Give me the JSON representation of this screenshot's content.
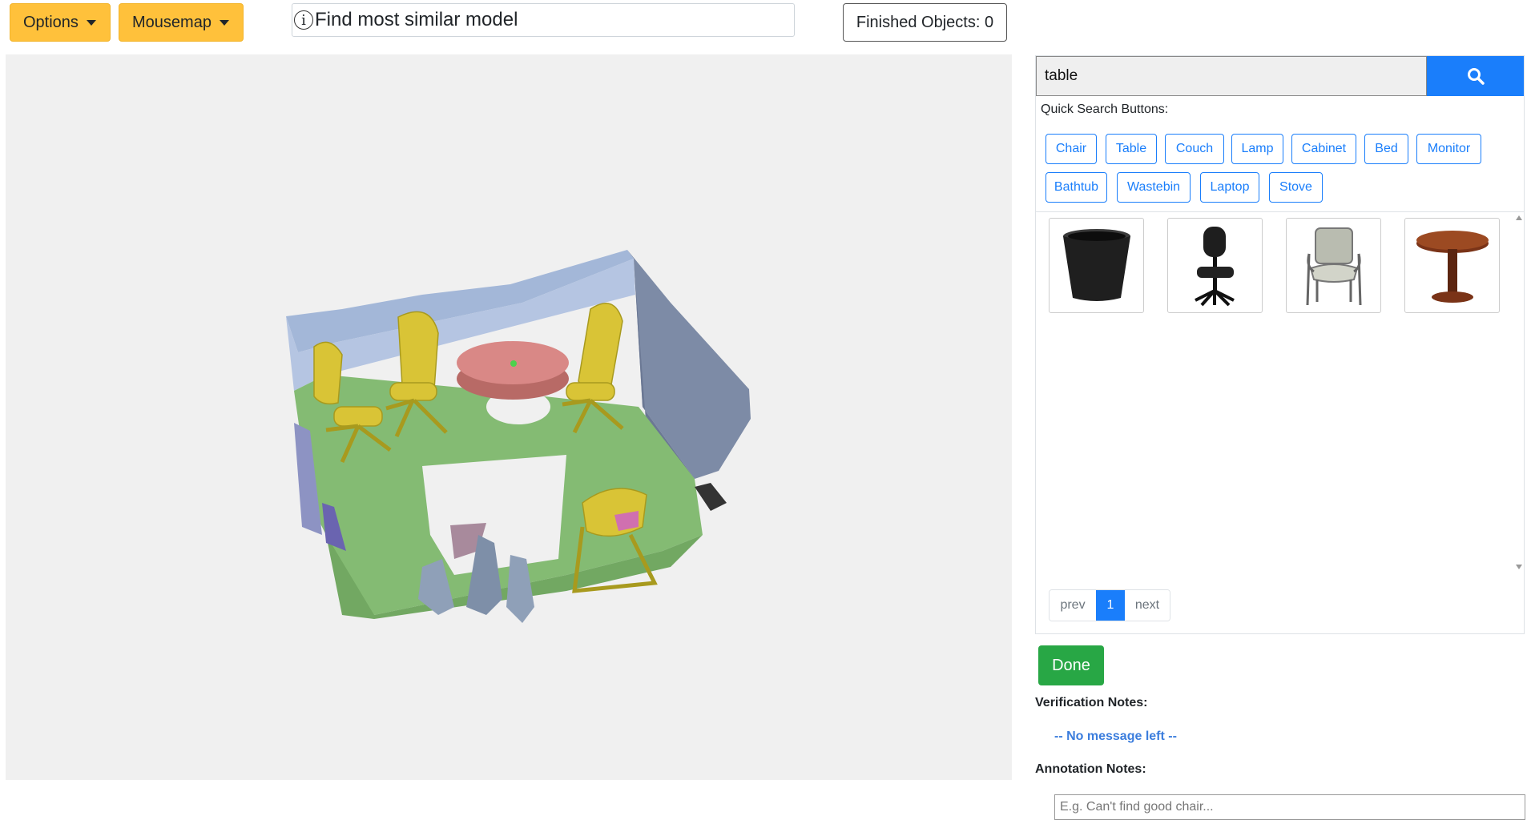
{
  "toolbar": {
    "options_label": "Options",
    "mousemap_label": "Mousemap",
    "hint_text": "Find most similar model",
    "finished_label": "Finished Objects: 0"
  },
  "search": {
    "value": "table",
    "button_icon": "search-icon"
  },
  "quick_search": {
    "label": "Quick Search Buttons:",
    "buttons": [
      "Chair",
      "Table",
      "Couch",
      "Lamp",
      "Cabinet",
      "Bed",
      "Monitor",
      "Bathtub",
      "Wastebin",
      "Laptop",
      "Stove"
    ]
  },
  "results": [
    {
      "icon": "wastebin-model"
    },
    {
      "icon": "office-chair-model"
    },
    {
      "icon": "armchair-model"
    },
    {
      "icon": "round-table-model"
    }
  ],
  "pagination": {
    "prev": "prev",
    "current": "1",
    "next": "next"
  },
  "done_label": "Done",
  "verification": {
    "label": "Verification Notes:",
    "message": "-- No message left --"
  },
  "annotation": {
    "label": "Annotation Notes:",
    "placeholder": "E.g. Can't find good chair..."
  },
  "colors": {
    "accent": "#1a7efb",
    "warning": "#ffc13b",
    "success": "#28a745"
  }
}
